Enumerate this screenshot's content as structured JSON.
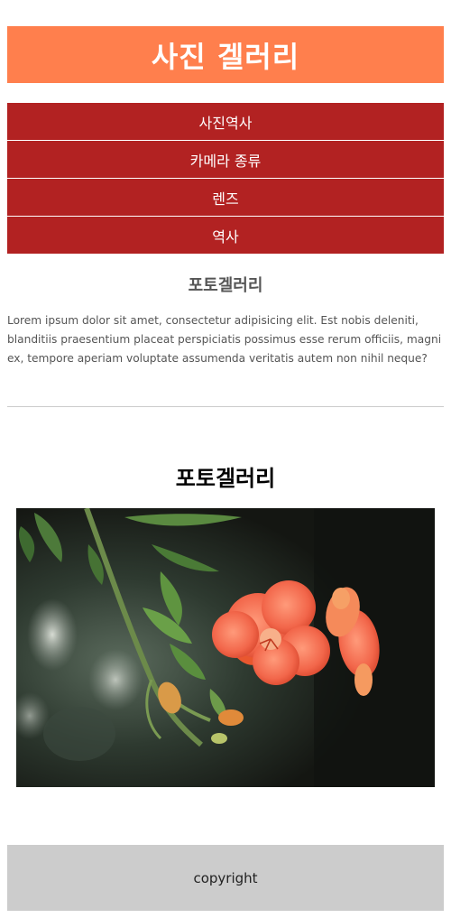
{
  "header": {
    "title": "사진 겔러리"
  },
  "nav": {
    "items": [
      {
        "label": "사진역사"
      },
      {
        "label": "카메라 종류"
      },
      {
        "label": "렌즈"
      },
      {
        "label": "역사"
      }
    ]
  },
  "intro": {
    "title": "포토겔러리",
    "text": "Lorem ipsum dolor sit amet, consectetur adipisicing elit. Est nobis deleniti, blanditiis praesentium placeat perspiciatis possimus esse rerum officiis, magni ex, tempore aperiam voluptate assumenda veritatis autem non nihil neque?"
  },
  "gallery": {
    "title": "포토겔러리"
  },
  "footer": {
    "text": "copyright"
  },
  "colors": {
    "header_bg": "#ff7f4d",
    "nav_bg": "#b22222",
    "footer_bg": "#cccccc"
  }
}
